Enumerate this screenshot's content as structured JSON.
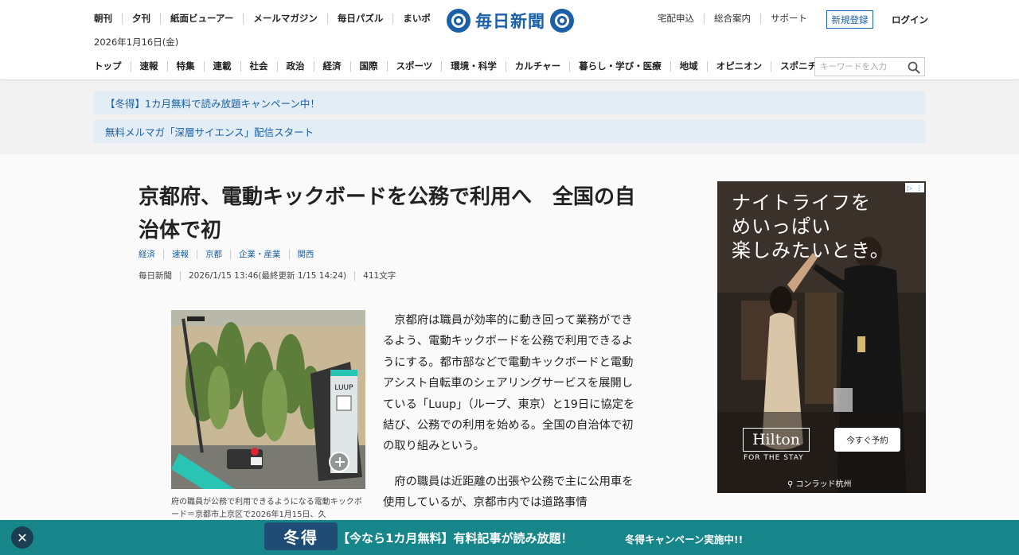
{
  "header": {
    "top_links": [
      "朝刊",
      "夕刊",
      "紙面ビューアー",
      "メールマガジン",
      "毎日パズル",
      "まいポ"
    ],
    "date": "2026年1月16日(金)",
    "logo_text": "毎日新聞",
    "util_links": [
      "宅配申込",
      "総合案内",
      "サポート"
    ],
    "register_label": "新規登録",
    "login_label": "ログイン",
    "nav": [
      "トップ",
      "速報",
      "特集",
      "連載",
      "社会",
      "政治",
      "経済",
      "国際",
      "スポーツ",
      "環境・科学",
      "カルチャー",
      "暮らし・学び・医療",
      "地域",
      "オピニオン",
      "スポニチ"
    ],
    "search_placeholder": "キーワードを入力"
  },
  "promos": [
    "【冬得】1カ月無料で読み放題キャンペーン中！",
    "無料メルマガ「深層サイエンス」配信スタート"
  ],
  "article": {
    "headline_line1": "京都府、電動キックボードを公務で利用へ　全国の自",
    "headline_line2": "治体で初",
    "tags": [
      "経済",
      "速報",
      "京都",
      "企業・産業",
      "関西"
    ],
    "meta": [
      "毎日新聞",
      "2026/1/15 13:46(最終更新 1/15 14:24)",
      "411文字"
    ],
    "caption": "府の職員が公務で利用できるようになる電動キックボード＝京都市上京区で2026年1月15日、久",
    "paragraphs": [
      "京都府は職員が効率的に動き回って業務ができるよう、電動キックボードを公務で利用できるようにする。都市部などで電動キックボードと電動アシスト自転車のシェアリングサービスを展開している「Luup」（ループ、東京）と19日に協定を結び、公務での利用を始める。全国の自治体で初の取り組みという。",
      "府の職員は近距離の出張や公務で主に公用車を使用しているが、京都市内では道路事情"
    ],
    "photo_sign": "LUUP"
  },
  "ad": {
    "copy": [
      "ナイトライフを",
      "めいっぱい",
      "楽しみたいとき。"
    ],
    "brand": "Hilton",
    "tagline": "FOR THE STAY",
    "cta": "今すぐ予約",
    "location": "コンラッド杭州"
  },
  "bottom_bar": {
    "close": "✕",
    "badge": "冬得",
    "text": "【今なら1カ月無料】有料記事が読み放題！",
    "sub": "冬得キャンペーン実施中!!"
  },
  "colors": {
    "brand_blue": "#1b5fa8",
    "promo_bg": "#e3edf6",
    "bottom_bar": "#17868a"
  }
}
